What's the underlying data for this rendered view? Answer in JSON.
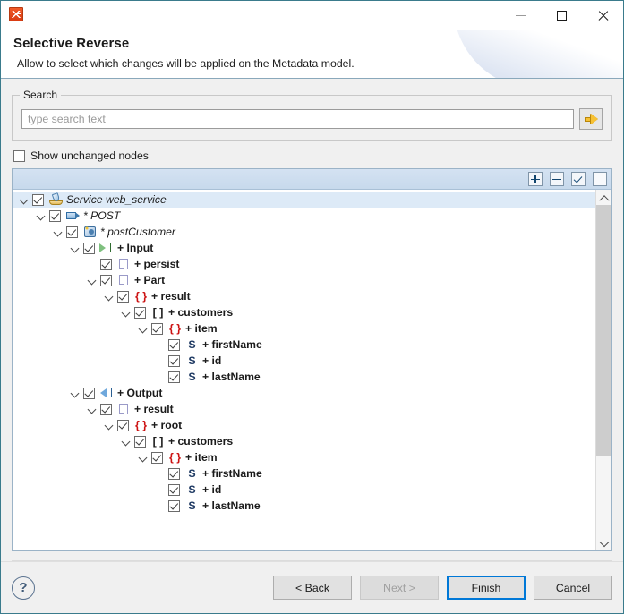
{
  "window": {
    "app_icon": "talend-app-icon",
    "minimize_label": "Minimize",
    "maximize_label": "Maximize",
    "close_label": "Close"
  },
  "header": {
    "title": "Selective Reverse",
    "subtitle": "Allow to select which changes will be applied on the Metadata model."
  },
  "search": {
    "group_label": "Search",
    "placeholder": "type search text",
    "value": "",
    "go_icon": "arrow-right-icon"
  },
  "options": {
    "show_unchanged_label": "Show unchanged nodes",
    "show_unchanged_checked": false
  },
  "tree_toolbar": {
    "expand_all_label": "+",
    "collapse_all_label": "−",
    "check_all_label": "✓",
    "uncheck_all_label": ""
  },
  "tree": {
    "rows": [
      {
        "indent": 0,
        "twisty": "open",
        "checked": true,
        "icon": "service-icon",
        "icon_kind": "service",
        "label": "Service web_service",
        "style": "italic",
        "selected": true
      },
      {
        "indent": 1,
        "twisty": "open",
        "checked": true,
        "icon": "post-method-icon",
        "icon_kind": "post",
        "label": "* POST",
        "style": "italic",
        "selected": false
      },
      {
        "indent": 2,
        "twisty": "open",
        "checked": true,
        "icon": "operation-icon",
        "icon_kind": "op",
        "label": "* postCustomer",
        "style": "italic",
        "selected": false
      },
      {
        "indent": 3,
        "twisty": "open",
        "checked": true,
        "icon": "input-icon",
        "icon_kind": "in",
        "label": "+ Input",
        "style": "bold",
        "selected": false
      },
      {
        "indent": 4,
        "twisty": "none",
        "checked": true,
        "icon": "parameter-icon",
        "icon_kind": "param",
        "label": "+ persist",
        "style": "bold",
        "selected": false
      },
      {
        "indent": 4,
        "twisty": "open",
        "checked": true,
        "icon": "parameter-icon",
        "icon_kind": "param",
        "label": "+ Part",
        "style": "bold",
        "selected": false
      },
      {
        "indent": 5,
        "twisty": "open",
        "checked": true,
        "icon": "object-icon",
        "icon_kind": "obj",
        "icon_text": "{ }",
        "label": "+ result",
        "style": "bold",
        "selected": false
      },
      {
        "indent": 6,
        "twisty": "open",
        "checked": true,
        "icon": "array-icon",
        "icon_kind": "arr",
        "icon_text": "[ ]",
        "label": "+ customers",
        "style": "bold",
        "selected": false
      },
      {
        "indent": 7,
        "twisty": "open",
        "checked": true,
        "icon": "object-icon",
        "icon_kind": "obj",
        "icon_text": "{ }",
        "label": "+ item",
        "style": "bold",
        "selected": false
      },
      {
        "indent": 8,
        "twisty": "none",
        "checked": true,
        "icon": "string-icon",
        "icon_kind": "str",
        "icon_text": "S",
        "label": "+ firstName",
        "style": "bold",
        "selected": false
      },
      {
        "indent": 8,
        "twisty": "none",
        "checked": true,
        "icon": "string-icon",
        "icon_kind": "str",
        "icon_text": "S",
        "label": "+ id",
        "style": "bold",
        "selected": false
      },
      {
        "indent": 8,
        "twisty": "none",
        "checked": true,
        "icon": "string-icon",
        "icon_kind": "str",
        "icon_text": "S",
        "label": "+ lastName",
        "style": "bold",
        "selected": false
      },
      {
        "indent": 3,
        "twisty": "open",
        "checked": true,
        "icon": "output-icon",
        "icon_kind": "out",
        "label": "+ Output",
        "style": "bold",
        "selected": false
      },
      {
        "indent": 4,
        "twisty": "open",
        "checked": true,
        "icon": "parameter-icon",
        "icon_kind": "param",
        "label": "+ result",
        "style": "bold",
        "selected": false
      },
      {
        "indent": 5,
        "twisty": "open",
        "checked": true,
        "icon": "object-icon",
        "icon_kind": "obj",
        "icon_text": "{ }",
        "label": "+ root",
        "style": "bold",
        "selected": false
      },
      {
        "indent": 6,
        "twisty": "open",
        "checked": true,
        "icon": "array-icon",
        "icon_kind": "arr",
        "icon_text": "[ ]",
        "label": "+ customers",
        "style": "bold",
        "selected": false
      },
      {
        "indent": 7,
        "twisty": "open",
        "checked": true,
        "icon": "object-icon",
        "icon_kind": "obj",
        "icon_text": "{ }",
        "label": "+ item",
        "style": "bold",
        "selected": false
      },
      {
        "indent": 8,
        "twisty": "none",
        "checked": true,
        "icon": "string-icon",
        "icon_kind": "str",
        "icon_text": "S",
        "label": "+ firstName",
        "style": "bold",
        "selected": false
      },
      {
        "indent": 8,
        "twisty": "none",
        "checked": true,
        "icon": "string-icon",
        "icon_kind": "str",
        "icon_text": "S",
        "label": "+ id",
        "style": "bold",
        "selected": false
      },
      {
        "indent": 8,
        "twisty": "none",
        "checked": true,
        "icon": "string-icon",
        "icon_kind": "str",
        "icon_text": "S",
        "label": "+ lastName",
        "style": "bold",
        "selected": false
      }
    ],
    "scroll_thumb_percent": 76
  },
  "footer": {
    "help_label": "?",
    "back_label": "< Back",
    "back_mnemonic": "B",
    "next_label": "Next >",
    "next_mnemonic": "N",
    "next_disabled": true,
    "finish_label": "Finish",
    "finish_mnemonic": "F",
    "finish_default": true,
    "cancel_label": "Cancel"
  },
  "colors": {
    "accent": "#0078d7",
    "selection": "#ddeaf7",
    "object_icon": "#cc1111",
    "string_icon": "#1f3a63",
    "toolbar_band": "#cfdff0"
  }
}
